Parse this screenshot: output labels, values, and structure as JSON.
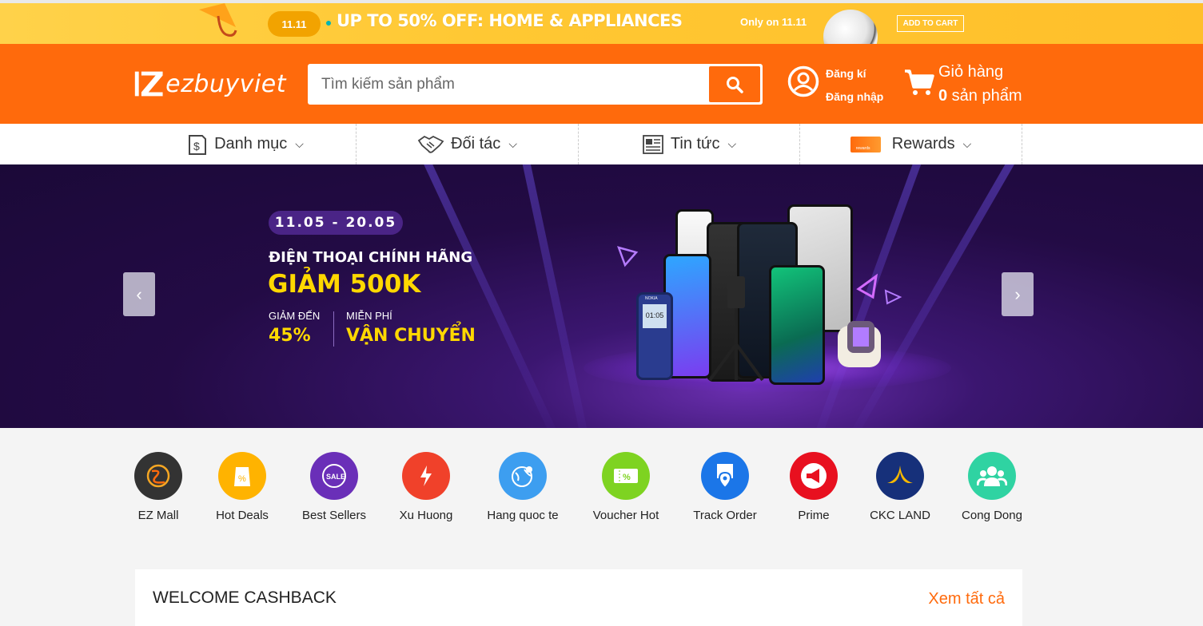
{
  "promo": {
    "badge": "11.11",
    "headline": "UP TO 50% OFF: HOME & APPLIANCES",
    "only_on": "Only on 11.11",
    "add_to_cart": "ADD TO CART"
  },
  "header": {
    "logo_text": "ezbuyviet",
    "search_placeholder": "Tìm kiếm sản phẩm",
    "register": "Đăng kí",
    "login": "Đăng nhập",
    "cart_title": "Giỏ hàng",
    "cart_count": "0",
    "cart_unit": " sản phẩm",
    "colors": {
      "brand": "#ff6a0c"
    }
  },
  "nav": {
    "items": [
      {
        "label": "Danh mục",
        "icon": "receipt-icon"
      },
      {
        "label": "Đối tác",
        "icon": "handshake-icon"
      },
      {
        "label": "Tin tức",
        "icon": "news-icon"
      },
      {
        "label": "Rewards",
        "icon": "rewards-icon"
      }
    ],
    "rewards_icon_text": "rewards"
  },
  "hero": {
    "date": "11.05 - 20.05",
    "line1": "ĐIỆN THOẠI CHÍNH HÃNG",
    "line2": "GIẢM 500K",
    "sub1_top": "GIẢM ĐẾN",
    "sub1_bottom": "45%",
    "sub2_top": "MIỄN PHÍ",
    "sub2_bottom": "VẬN CHUYỂN",
    "phone_time": "01:05",
    "phone_brand": "NOKIA"
  },
  "categories": [
    {
      "label": "EZ Mall",
      "icon": "ez-mall-icon",
      "color": "#333333"
    },
    {
      "label": "Hot Deals",
      "icon": "hot-deals-icon",
      "color": "#ffb300"
    },
    {
      "label": "Best Sellers",
      "icon": "sale-icon",
      "color": "#6a2fb8"
    },
    {
      "label": "Xu Huong",
      "icon": "trend-icon",
      "color": "#f0412a"
    },
    {
      "label": "Hang quoc te",
      "icon": "globe-icon",
      "color": "#3d9ef0"
    },
    {
      "label": "Voucher Hot",
      "icon": "voucher-icon",
      "color": "#7ed321"
    },
    {
      "label": "Track Order",
      "icon": "track-order-icon",
      "color": "#1b76e8"
    },
    {
      "label": "Prime",
      "icon": "megaphone-icon",
      "color": "#e8101f"
    },
    {
      "label": "CKC LAND",
      "icon": "ckc-land-icon",
      "color": "#16307a"
    },
    {
      "label": "Cong Dong",
      "icon": "community-icon",
      "color": "#2fd3a2"
    }
  ],
  "cashback": {
    "title": "WELCOME CASHBACK",
    "more": "Xem tất cả"
  }
}
